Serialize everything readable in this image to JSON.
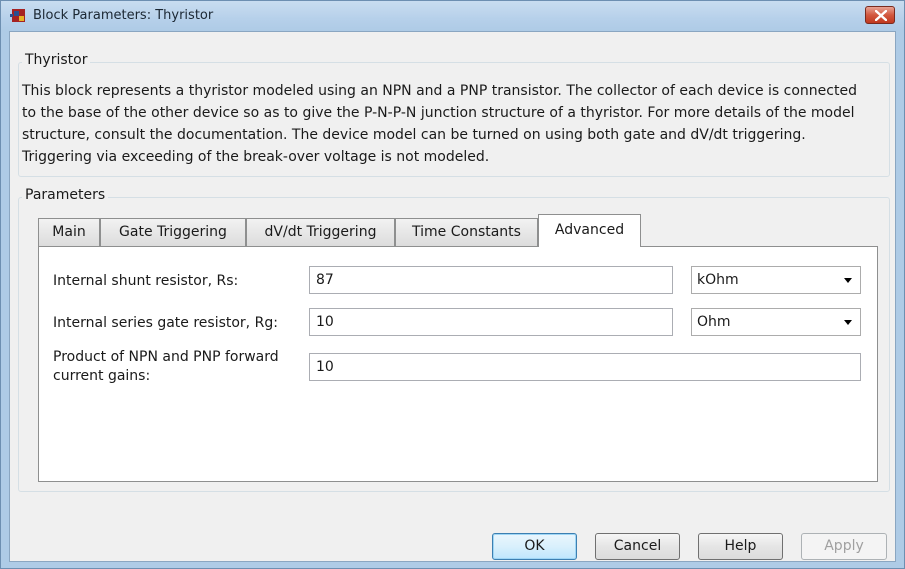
{
  "window": {
    "title": "Block Parameters: Thyristor"
  },
  "block_group": {
    "legend": "Thyristor",
    "description": "This block represents a thyristor modeled using an NPN and a PNP transistor. The collector of each device is connected to the base of the other device so as to give the P-N-P-N junction structure of a thyristor. For more details of the model structure, consult the documentation. The device model can be turned on using both gate and dV/dt triggering. Triggering via exceeding of the break-over voltage is not modeled."
  },
  "params_group": {
    "legend": "Parameters"
  },
  "tabs": [
    {
      "label": "Main"
    },
    {
      "label": "Gate Triggering"
    },
    {
      "label": "dV/dt Triggering"
    },
    {
      "label": "Time Constants"
    },
    {
      "label": "Advanced"
    }
  ],
  "active_tab": "Advanced",
  "fields": {
    "rs": {
      "label": "Internal shunt resistor, Rs:",
      "value": "87",
      "unit": "kOhm"
    },
    "rg": {
      "label": "Internal series gate resistor, Rg:",
      "value": "10",
      "unit": "Ohm"
    },
    "gain": {
      "label_line1": "Product of NPN and PNP forward",
      "label_line2": "current gains:",
      "value": "10"
    }
  },
  "buttons": {
    "ok": "OK",
    "cancel": "Cancel",
    "help": "Help",
    "apply": "Apply"
  },
  "icons": {
    "app": "simulink-block-icon",
    "close": "close-icon",
    "dropdown": "chevron-down-icon"
  },
  "colors": {
    "titlebar": "#b6d0ea",
    "close": "#c9462b",
    "background": "#f0f0f0"
  }
}
